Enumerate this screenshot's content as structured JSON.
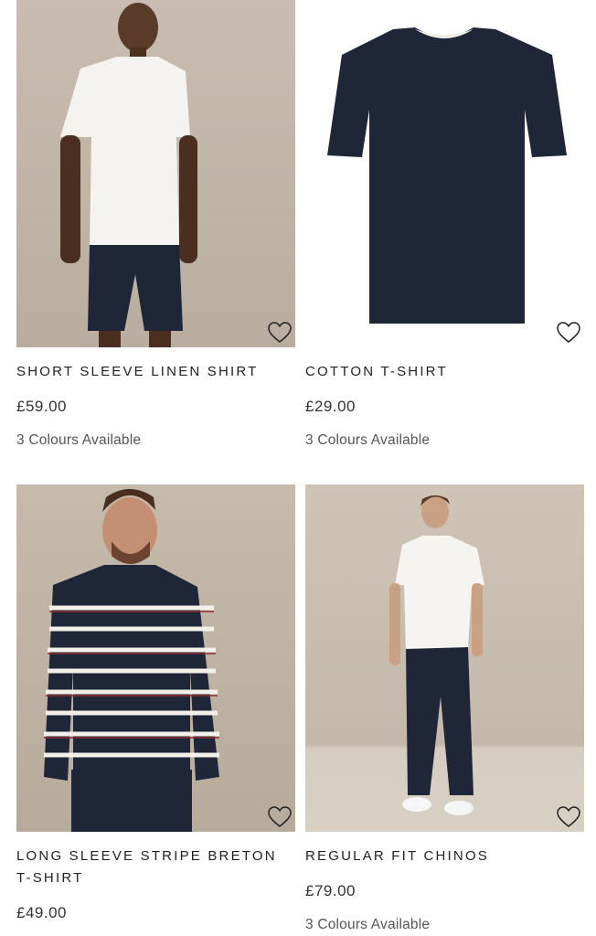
{
  "products": [
    {
      "title": "SHORT SLEEVE LINEN SHIRT",
      "price": "£59.00",
      "colours": "3 Colours Available"
    },
    {
      "title": "COTTON T-SHIRT",
      "price": "£29.00",
      "colours": "3 Colours Available"
    },
    {
      "title": "LONG SLEEVE STRIPE BRETON T-SHIRT",
      "price": "£49.00",
      "colours": ""
    },
    {
      "title": "REGULAR FIT CHINOS",
      "price": "£79.00",
      "colours": "3 Colours Available"
    }
  ],
  "icons": {
    "wishlist": "heart-outline-icon"
  },
  "colors": {
    "navy": "#1f2638",
    "background_beige": "#c4b8aa",
    "text": "#222222"
  }
}
